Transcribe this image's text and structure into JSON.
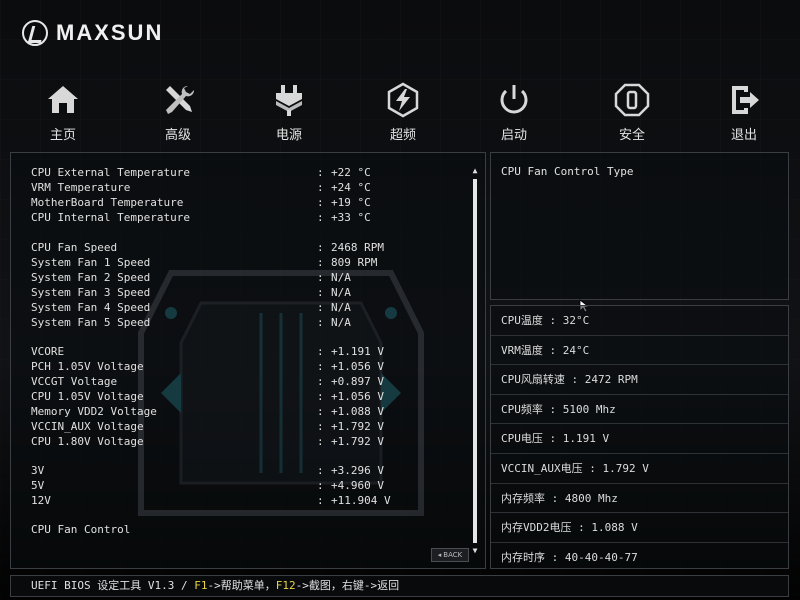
{
  "brand": {
    "name": "MAXSUN"
  },
  "nav": [
    {
      "label": "主页",
      "icon": "home-icon"
    },
    {
      "label": "高级",
      "icon": "tools-icon"
    },
    {
      "label": "电源",
      "icon": "power-plug-icon"
    },
    {
      "label": "超频",
      "icon": "lightning-icon"
    },
    {
      "label": "启动",
      "icon": "power-button-icon"
    },
    {
      "label": "安全",
      "icon": "shield-icon"
    },
    {
      "label": "退出",
      "icon": "exit-icon"
    }
  ],
  "monitor": [
    {
      "label": "CPU External Temperature",
      "sep": ":",
      "value": "+22 °C"
    },
    {
      "label": "VRM Temperature",
      "sep": ":",
      "value": "+24 °C"
    },
    {
      "label": "MotherBoard Temperature",
      "sep": ":",
      "value": "+19 °C"
    },
    {
      "label": "CPU Internal Temperature",
      "sep": ":",
      "value": "+33 °C"
    },
    {
      "label": "CPU Fan Speed",
      "sep": ":",
      "value": "2468 RPM"
    },
    {
      "label": "System Fan 1 Speed",
      "sep": ":",
      "value": "809 RPM"
    },
    {
      "label": "System Fan 2 Speed",
      "sep": ":",
      "value": "N/A"
    },
    {
      "label": "System Fan 3 Speed",
      "sep": ":",
      "value": "N/A"
    },
    {
      "label": "System Fan 4 Speed",
      "sep": ":",
      "value": "N/A"
    },
    {
      "label": "System Fan 5 Speed",
      "sep": ":",
      "value": "N/A"
    },
    {
      "label": "VCORE",
      "sep": ":",
      "value": "+1.191 V"
    },
    {
      "label": "PCH 1.05V Voltage",
      "sep": ":",
      "value": "+1.056 V"
    },
    {
      "label": "VCCGT Voltage",
      "sep": ":",
      "value": "+0.897 V"
    },
    {
      "label": "CPU 1.05V Voltage",
      "sep": ":",
      "value": "+1.056 V"
    },
    {
      "label": "Memory VDD2 Voltage",
      "sep": ":",
      "value": "+1.088 V"
    },
    {
      "label": "VCCIN_AUX Voltage",
      "sep": ":",
      "value": "+1.792 V"
    },
    {
      "label": "CPU 1.80V Voltage",
      "sep": ":",
      "value": "+1.792 V"
    },
    {
      "label": "3V",
      "sep": ":",
      "value": "+3.296 V"
    },
    {
      "label": "5V",
      "sep": ":",
      "value": "+4.960 V"
    },
    {
      "label": "12V",
      "sep": ":",
      "value": "+11.904 V"
    },
    {
      "label": "CPU Fan Control",
      "sep": "",
      "value": ""
    }
  ],
  "back_label": "BACK",
  "help": {
    "text": "CPU Fan Control Type"
  },
  "stats": [
    "CPU温度 : 32°C",
    "VRM温度 : 24°C",
    "CPU风扇转速 : 2472 RPM",
    "CPU频率 : 5100 Mhz",
    "CPU电压 : 1.191 V",
    "VCCIN_AUX电压 : 1.792 V",
    "内存频率 : 4800 Mhz",
    "内存VDD2电压 : 1.088 V",
    "内存时序 : 40-40-40-77"
  ],
  "footer": {
    "prefix": "UEFI BIOS 设定工具 V1.3 / ",
    "f1_key": "F1",
    "f1_text": "->帮助菜单，",
    "f12_key": "F12",
    "f12_text": "->截图，右键->返回"
  },
  "colors": {
    "key_highlight": "#e8d44a",
    "border": "#3a3d42",
    "background": "#0b0c0e"
  }
}
